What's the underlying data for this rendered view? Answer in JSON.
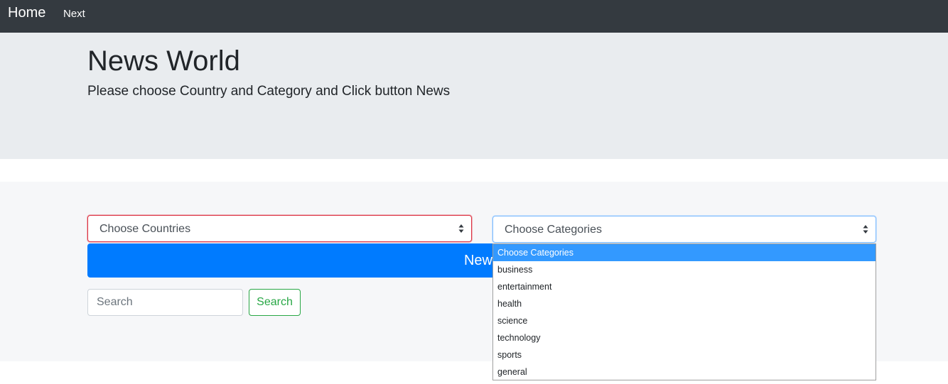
{
  "navbar": {
    "brand": "Home",
    "next_link": "Next"
  },
  "jumbotron": {
    "title": "News World",
    "lead": "Please choose Country and Category and Click button News"
  },
  "form": {
    "country_select": {
      "value": "Choose Countries"
    },
    "category_select": {
      "value": "Choose Categories"
    },
    "news_button": "News",
    "search_input": {
      "placeholder": "Search",
      "value": ""
    },
    "search_button": "Search"
  },
  "category_dropdown": {
    "selected_index": 0,
    "options": [
      "Choose Categories",
      "business",
      "entertainment",
      "health",
      "science",
      "technology",
      "sports",
      "general"
    ]
  },
  "colors": {
    "navbar_bg": "#343a40",
    "jumbotron_bg": "#e9ecef",
    "primary": "#007bff",
    "success": "#28a745",
    "danger_border": "#dc3545",
    "focus_border": "#80bdff",
    "option_highlight": "#3399ff"
  }
}
